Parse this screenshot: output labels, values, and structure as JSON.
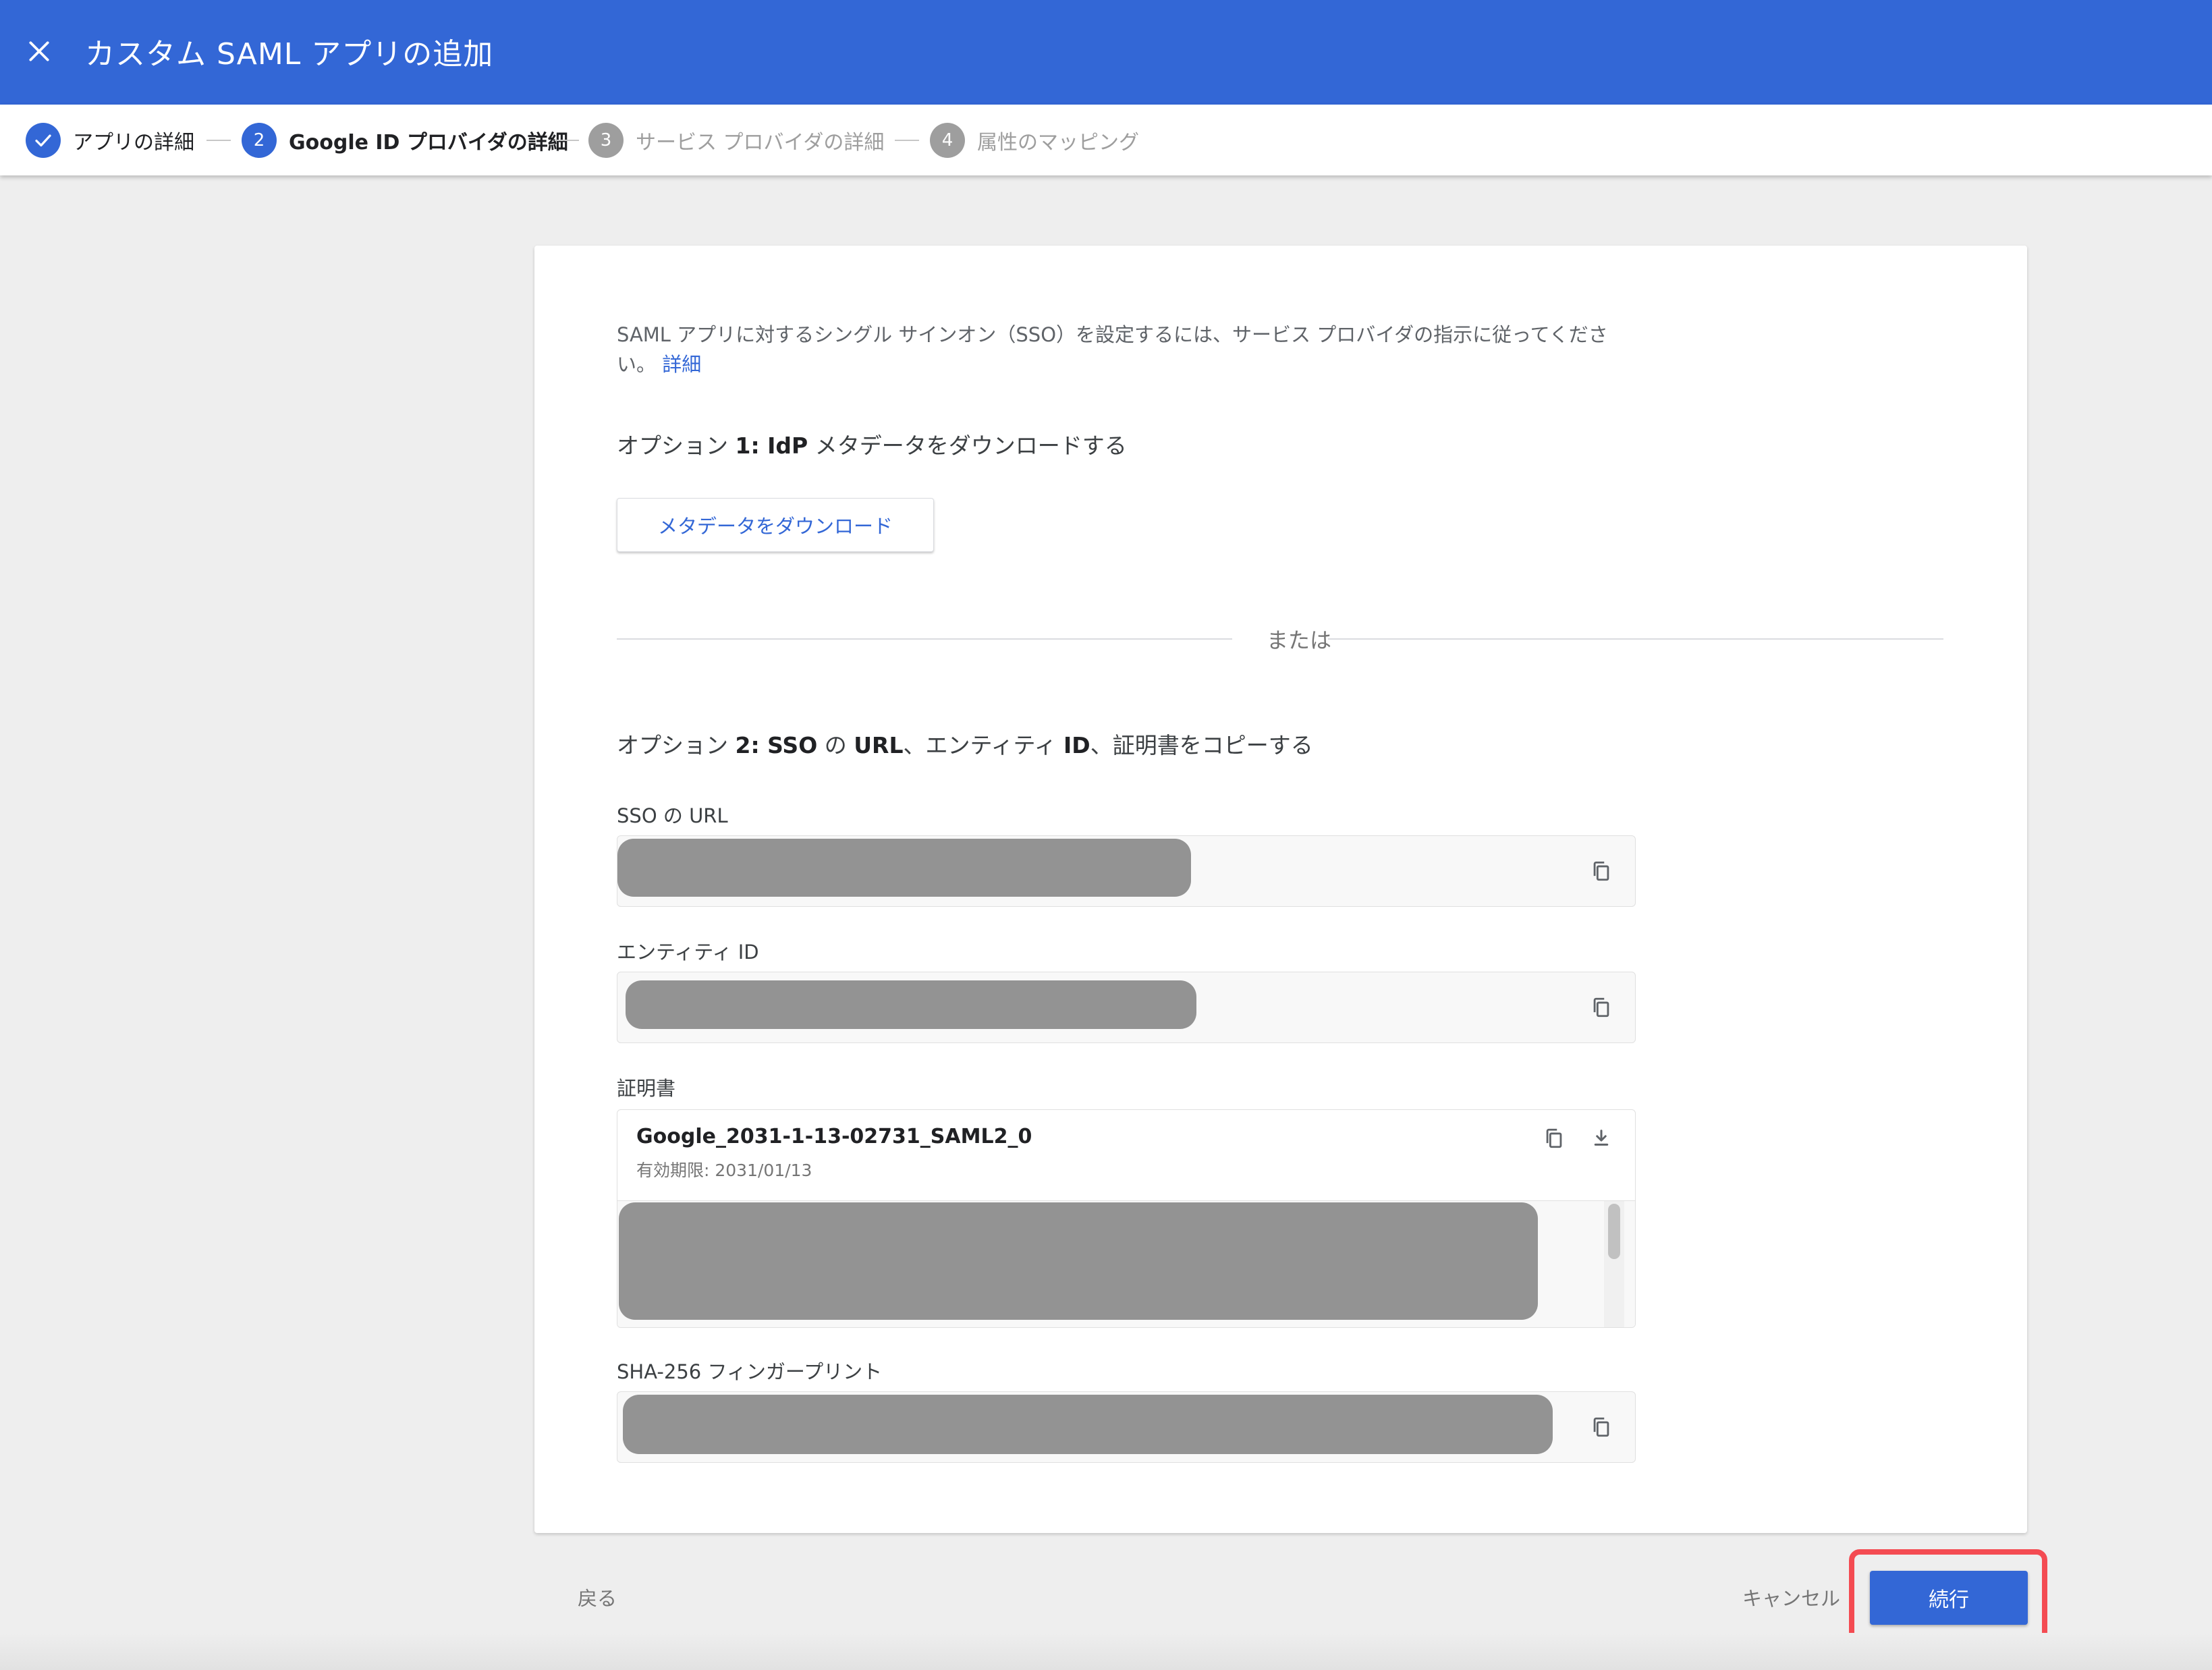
{
  "header": {
    "title": "カスタム SAML アプリの追加",
    "close_icon": "close-icon"
  },
  "stepper": {
    "steps": [
      {
        "number": "1",
        "label": "アプリの詳細",
        "state": "done"
      },
      {
        "number": "2",
        "label": "Google ID プロバイダの詳細",
        "state": "active"
      },
      {
        "number": "3",
        "label": "サービス プロバイダの詳細",
        "state": "todo"
      },
      {
        "number": "4",
        "label": "属性のマッピング",
        "state": "todo"
      }
    ]
  },
  "card": {
    "intro_text": "SAML アプリに対するシングル サインオン（SSO）を設定するには、サービス プロバイダの指示に従ってください。",
    "intro_link": "詳細",
    "option1_prefix": "オプション ",
    "option1_bold": "1: IdP",
    "option1_suffix": " メタデータをダウンロードする",
    "download_button": "メタデータをダウンロード",
    "divider_text": "または",
    "option2_prefix": "オプション ",
    "option2_bold1": "2: SSO",
    "option2_mid1": " の ",
    "option2_bold2": "URL",
    "option2_mid2": "、エンティティ ",
    "option2_bold3": "ID",
    "option2_suffix": "、証明書をコピーする",
    "sso_url_label": "SSO の URL",
    "entity_id_label": "エンティティ ID",
    "certificate_label": "証明書",
    "certificate_name": "Google_2031-1-13-02731_SAML2_0",
    "certificate_expiry": "有効期限: 2031/01/13",
    "fingerprint_label": "SHA-256 フィンガープリント"
  },
  "footer": {
    "back_label": "戻る",
    "cancel_label": "キャンセル",
    "continue_label": "続行"
  },
  "colors": {
    "brand": "#3367d6",
    "highlight": "#f44b52",
    "redaction": "#939393"
  }
}
